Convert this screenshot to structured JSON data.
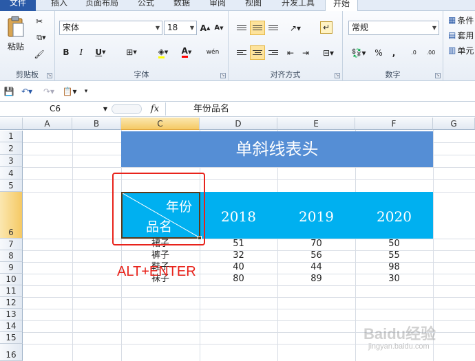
{
  "tabs": [
    "文件",
    "插入",
    "页面布局",
    "公式",
    "数据",
    "审阅",
    "视图",
    "开发工具",
    "开始"
  ],
  "clipboard": {
    "paste_label": "粘贴",
    "group_label": "剪贴板"
  },
  "font": {
    "family": "宋体",
    "size": "18",
    "group_label": "字体",
    "bold": "B",
    "italic": "I",
    "underline": "U",
    "font_color": "A",
    "grow": "A",
    "shrink": "A",
    "phonetic": "wén"
  },
  "alignment": {
    "group_label": "对齐方式"
  },
  "number": {
    "format": "常规",
    "group_label": "数字",
    "percent": "%",
    "comma": ",",
    "inc_decimal": ".0",
    "dec_decimal": ".00"
  },
  "styles": {
    "conditional": "条件",
    "table": "套用",
    "cell": "单元"
  },
  "formula_bar": {
    "cell_ref": "C6",
    "fx_label": "fx",
    "value": "年份品名"
  },
  "columns": [
    "A",
    "B",
    "C",
    "D",
    "E",
    "F",
    "G"
  ],
  "rows": [
    "1",
    "2",
    "3",
    "4",
    "5",
    "6",
    "7",
    "8",
    "9",
    "10",
    "11",
    "12",
    "13",
    "14",
    "15",
    "16"
  ],
  "sheet": {
    "title": "单斜线表头",
    "header_top": "年份",
    "header_bottom": "品名",
    "years": [
      "2018",
      "2019",
      "2020"
    ],
    "items": [
      {
        "name": "裙子",
        "v2018": "51",
        "v2019": "70",
        "v2020": "50"
      },
      {
        "name": "裤子",
        "v2018": "32",
        "v2019": "56",
        "v2020": "55"
      },
      {
        "name": "鞋子",
        "v2018": "40",
        "v2019": "44",
        "v2020": "98"
      },
      {
        "name": "袜子",
        "v2018": "80",
        "v2019": "89",
        "v2020": "30"
      }
    ]
  },
  "annotation": "ALT+ENTER",
  "watermark": {
    "logo": "Baidu经验",
    "url": "jingyan.baidu.com"
  },
  "colors": {
    "title_fill": "#558ed5",
    "header_fill": "#00b0f0",
    "annotation": "#e8231b"
  }
}
